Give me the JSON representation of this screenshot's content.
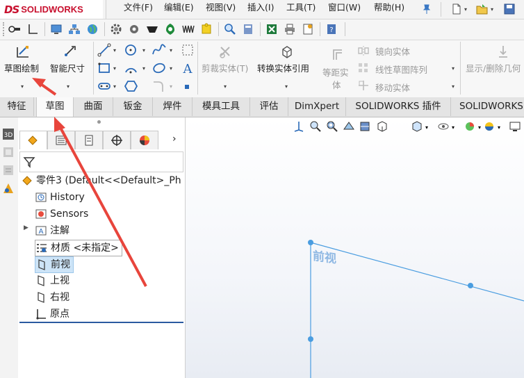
{
  "app": {
    "logo_ds": "DS",
    "logo_text": "SOLIDWORKS"
  },
  "menu": [
    "文件(F)",
    "编辑(E)",
    "视图(V)",
    "插入(I)",
    "工具(T)",
    "窗口(W)",
    "帮助(H)"
  ],
  "command_manager": {
    "sketch": "草图绘制",
    "smart_dim": "智能尺寸",
    "trim": "剪裁实体(T)",
    "convert": "转换实体引用",
    "offset": [
      "等距实",
      "体"
    ],
    "mirror": "镜向实体",
    "linear_pattern": "线性草图阵列",
    "move": "移动实体",
    "show_hide": "显示/删除几何"
  },
  "tabs": [
    "特征",
    "草图",
    "曲面",
    "钣金",
    "焊件",
    "模具工具",
    "评估",
    "DimXpert",
    "SOLIDWORKS 插件",
    "SOLIDWORKS"
  ],
  "active_tab": "草图",
  "tree": {
    "root": "零件3  (Default<<Default>_Ph",
    "items": {
      "history": "History",
      "sensors": "Sensors",
      "annotations": "注解",
      "material": "材质 <未指定>",
      "front": "前视",
      "top": "上视",
      "right": "右视",
      "origin": "原点"
    }
  },
  "viewport": {
    "plane_label": "前视"
  },
  "colors": {
    "accent": "#c8102e",
    "sketch_line": "#4a9de0",
    "selection": "#cde4f7",
    "arrow": "#e8453c"
  }
}
